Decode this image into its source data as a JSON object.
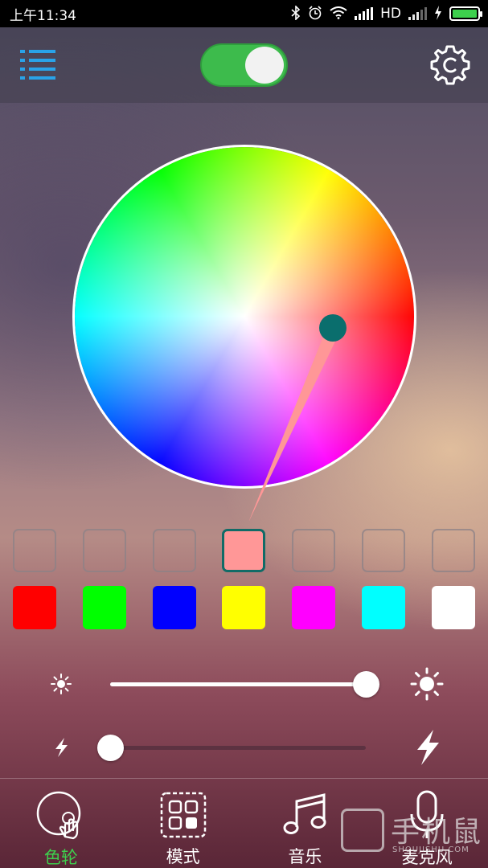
{
  "status_bar": {
    "time": "上午11:34",
    "network_label": "HD",
    "icons": [
      "bluetooth-icon",
      "alarm-icon",
      "wifi-icon",
      "signal-icon",
      "signal-icon",
      "charging-icon",
      "battery-icon"
    ],
    "battery_color": "#3dd04d"
  },
  "header": {
    "menu_icon": "list-menu-icon",
    "power_toggle_on": true,
    "toggle_color": "#3dbb4c",
    "settings_icon": "gear-icon"
  },
  "color_wheel": {
    "selected_color": "#ff9797",
    "pointer_color": "#0a6e6d"
  },
  "custom_slots": [
    {
      "color": "",
      "selected": false
    },
    {
      "color": "",
      "selected": false
    },
    {
      "color": "",
      "selected": false
    },
    {
      "color": "#ff9797",
      "selected": true
    },
    {
      "color": "",
      "selected": false
    },
    {
      "color": "",
      "selected": false
    },
    {
      "color": "",
      "selected": false
    }
  ],
  "preset_colors": [
    "#ff0000",
    "#00ff00",
    "#0000ff",
    "#ffff00",
    "#ff00ff",
    "#00ffff",
    "#ffffff"
  ],
  "brightness": {
    "icon_low": "sun-small-icon",
    "icon_high": "sun-large-icon",
    "value_fraction": 1.0
  },
  "speed": {
    "icon_low": "lightning-small-icon",
    "icon_high": "lightning-large-icon",
    "value_fraction": 0.0
  },
  "bottom_nav": [
    {
      "label": "色轮",
      "icon": "color-wheel-touch-icon",
      "active": true
    },
    {
      "label": "模式",
      "icon": "mode-grid-icon",
      "active": false
    },
    {
      "label": "音乐",
      "icon": "music-note-icon",
      "active": false
    },
    {
      "label": "麦克风",
      "icon": "microphone-icon",
      "active": false
    }
  ],
  "watermark": {
    "text": "手机鼠",
    "subtext": "SHOUJISHU.COM"
  }
}
